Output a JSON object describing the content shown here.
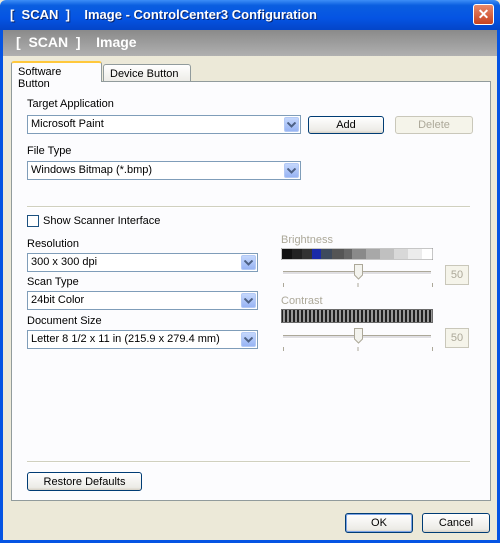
{
  "window": {
    "title": "[  SCAN  ]    Image - ControlCenter3 Configuration",
    "header": "[  SCAN  ]    Image"
  },
  "tabs": [
    {
      "label": "Software Button",
      "active": true
    },
    {
      "label": "Device Button",
      "active": false
    }
  ],
  "target_application": {
    "label": "Target Application",
    "value": "Microsoft Paint",
    "add_label": "Add",
    "delete_label": "Delete"
  },
  "file_type": {
    "label": "File Type",
    "value": "Windows Bitmap (*.bmp)"
  },
  "scanner_interface": {
    "label": "Show Scanner Interface",
    "checked": false
  },
  "resolution": {
    "label": "Resolution",
    "value": "300 x 300 dpi"
  },
  "scan_type": {
    "label": "Scan Type",
    "value": "24bit Color"
  },
  "document_size": {
    "label": "Document Size",
    "value": "Letter 8 1/2 x 11 in (215.9 x 279.4 mm)"
  },
  "brightness": {
    "label": "Brightness",
    "value": "50",
    "enabled": false
  },
  "contrast": {
    "label": "Contrast",
    "value": "50",
    "enabled": false
  },
  "buttons": {
    "restore_defaults": "Restore Defaults",
    "ok": "OK",
    "cancel": "Cancel"
  },
  "colors": {
    "titlebar": "#0554e3",
    "header_band": "#9a9a9a",
    "dialog_bg": "#ece9d8",
    "disabled_text": "#aca899"
  }
}
